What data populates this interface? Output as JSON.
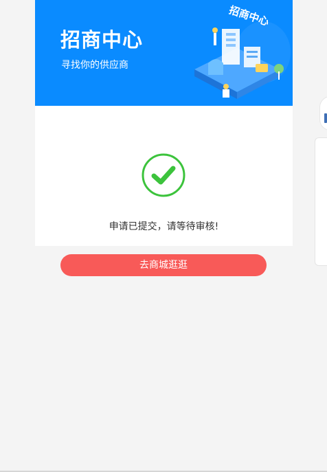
{
  "banner": {
    "title": "招商中心",
    "subtitle": "寻找你的供应商",
    "illustration_text": "招商中心",
    "background_color": "#0a8bff"
  },
  "status": {
    "icon": "check-circle-icon",
    "icon_color": "#3cc33c",
    "message": "申请已提交，请等待审核!"
  },
  "actions": {
    "go_mall_label": "去商城逛逛",
    "button_color": "#f85a58"
  }
}
